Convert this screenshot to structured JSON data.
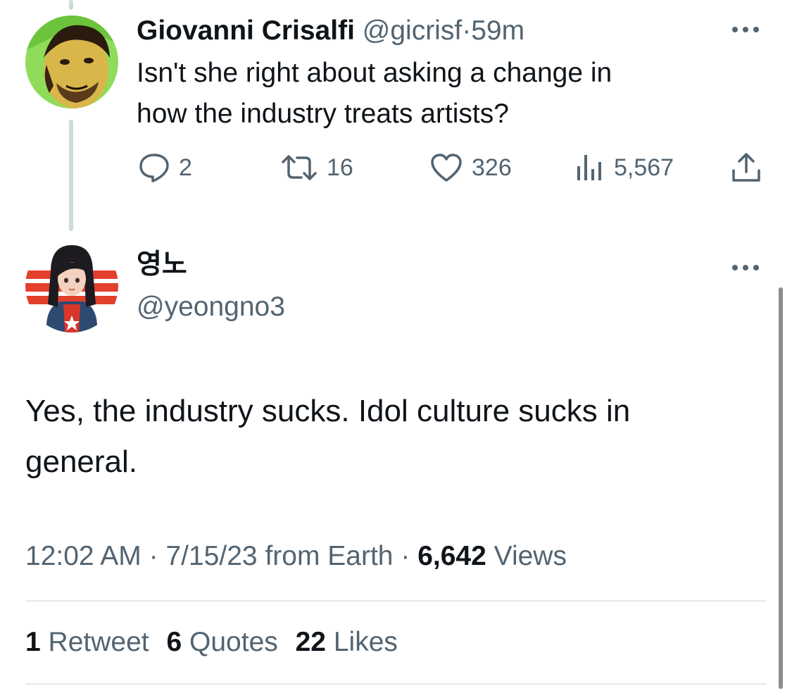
{
  "parent_tweet": {
    "author_name": "Giovanni Crisalfi",
    "handle": "@gicrisf",
    "separator": "·",
    "time": "59m",
    "text_line1": "Isn't she right about asking a change in",
    "text_line2": "how the industry treats artists?",
    "replies": "2",
    "retweets": "16",
    "likes": "326",
    "views": "5,567"
  },
  "main_tweet": {
    "author_name": "영노",
    "handle": "@yeongno3",
    "text_line1": "Yes, the industry sucks. Idol culture sucks in",
    "text_line2": "general.",
    "time": "12:02 AM",
    "sep1": "·",
    "date": "7/15/23",
    "source": "from Earth",
    "sep2": "·",
    "views_count": "6,642",
    "views_label": "Views",
    "retweet_count": "1",
    "retweet_label": "Retweet",
    "quote_count": "6",
    "quote_label": "Quotes",
    "like_count": "22",
    "like_label": "Likes"
  },
  "icons": {
    "more": "more-icon",
    "reply": "reply-icon",
    "retweet": "retweet-icon",
    "like": "heart-icon",
    "views": "views-icon",
    "share": "share-icon"
  },
  "colors": {
    "text": "#0f1419",
    "muted": "#536471",
    "divider": "#e5e9ec",
    "thread_line": "#cfd9de"
  }
}
